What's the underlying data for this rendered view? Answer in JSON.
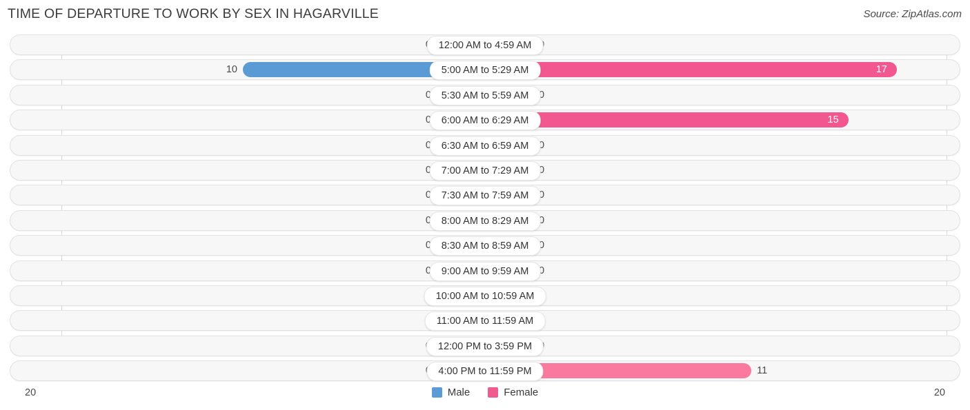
{
  "header": {
    "title": "TIME OF DEPARTURE TO WORK BY SEX IN HAGARVILLE",
    "source": "Source: ZipAtlas.com"
  },
  "axis": {
    "left_end": "20",
    "right_end": "20"
  },
  "legend": {
    "items": [
      {
        "label": "Male",
        "color": "#5b9bd5"
      },
      {
        "label": "Female",
        "color": "#ee5b8c"
      }
    ]
  },
  "colors": {
    "male_active": "#5b9bd5",
    "male_zero": "#a8c8ec",
    "female_high": "#f2578f",
    "female_mid": "#f9799f",
    "female_zero": "#f5a8c4",
    "track_bg": "#f7f7f7",
    "track_border": "#e2e2e2",
    "gridline": "#d9d9d9"
  },
  "chart_data": {
    "type": "bar",
    "title": "TIME OF DEPARTURE TO WORK BY SEX IN HAGARVILLE",
    "subtitle": "",
    "xlabel": "",
    "ylabel": "",
    "orientation": "horizontal-diverging",
    "grid": true,
    "legend_position": "bottom-center",
    "axis_max": 20,
    "axis_tick_labels": [
      "20",
      "20"
    ],
    "categories": [
      "12:00 AM to 4:59 AM",
      "5:00 AM to 5:29 AM",
      "5:30 AM to 5:59 AM",
      "6:00 AM to 6:29 AM",
      "6:30 AM to 6:59 AM",
      "7:00 AM to 7:29 AM",
      "7:30 AM to 7:59 AM",
      "8:00 AM to 8:29 AM",
      "8:30 AM to 8:59 AM",
      "9:00 AM to 9:59 AM",
      "10:00 AM to 10:59 AM",
      "11:00 AM to 11:59 AM",
      "12:00 PM to 3:59 PM",
      "4:00 PM to 11:59 PM"
    ],
    "series": [
      {
        "name": "Male",
        "direction": "left",
        "values": [
          0,
          10,
          0,
          0,
          0,
          0,
          0,
          0,
          0,
          0,
          0,
          0,
          0,
          0
        ],
        "labels": [
          "0",
          "10",
          "0",
          "0",
          "0",
          "0",
          "0",
          "0",
          "0",
          "0",
          "0",
          "0",
          "0",
          "0"
        ]
      },
      {
        "name": "Female",
        "direction": "right",
        "values": [
          0,
          17,
          0,
          15,
          0,
          0,
          0,
          0,
          0,
          0,
          0,
          0,
          0,
          11
        ],
        "labels": [
          "0",
          "17",
          "0",
          "15",
          "0",
          "0",
          "0",
          "0",
          "0",
          "0",
          "0",
          "0",
          "0",
          "11"
        ]
      }
    ]
  }
}
